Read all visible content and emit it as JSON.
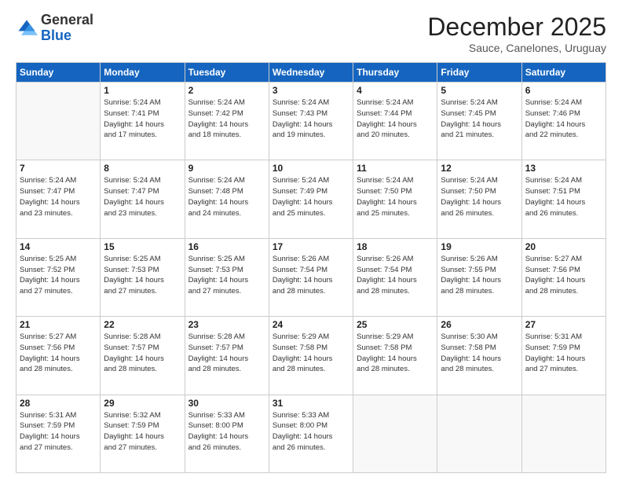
{
  "header": {
    "logo_general": "General",
    "logo_blue": "Blue",
    "month_title": "December 2025",
    "location": "Sauce, Canelones, Uruguay"
  },
  "days_of_week": [
    "Sunday",
    "Monday",
    "Tuesday",
    "Wednesday",
    "Thursday",
    "Friday",
    "Saturday"
  ],
  "weeks": [
    [
      {
        "day": "",
        "info": ""
      },
      {
        "day": "1",
        "info": "Sunrise: 5:24 AM\nSunset: 7:41 PM\nDaylight: 14 hours\nand 17 minutes."
      },
      {
        "day": "2",
        "info": "Sunrise: 5:24 AM\nSunset: 7:42 PM\nDaylight: 14 hours\nand 18 minutes."
      },
      {
        "day": "3",
        "info": "Sunrise: 5:24 AM\nSunset: 7:43 PM\nDaylight: 14 hours\nand 19 minutes."
      },
      {
        "day": "4",
        "info": "Sunrise: 5:24 AM\nSunset: 7:44 PM\nDaylight: 14 hours\nand 20 minutes."
      },
      {
        "day": "5",
        "info": "Sunrise: 5:24 AM\nSunset: 7:45 PM\nDaylight: 14 hours\nand 21 minutes."
      },
      {
        "day": "6",
        "info": "Sunrise: 5:24 AM\nSunset: 7:46 PM\nDaylight: 14 hours\nand 22 minutes."
      }
    ],
    [
      {
        "day": "7",
        "info": "Sunrise: 5:24 AM\nSunset: 7:47 PM\nDaylight: 14 hours\nand 23 minutes."
      },
      {
        "day": "8",
        "info": "Sunrise: 5:24 AM\nSunset: 7:47 PM\nDaylight: 14 hours\nand 23 minutes."
      },
      {
        "day": "9",
        "info": "Sunrise: 5:24 AM\nSunset: 7:48 PM\nDaylight: 14 hours\nand 24 minutes."
      },
      {
        "day": "10",
        "info": "Sunrise: 5:24 AM\nSunset: 7:49 PM\nDaylight: 14 hours\nand 25 minutes."
      },
      {
        "day": "11",
        "info": "Sunrise: 5:24 AM\nSunset: 7:50 PM\nDaylight: 14 hours\nand 25 minutes."
      },
      {
        "day": "12",
        "info": "Sunrise: 5:24 AM\nSunset: 7:50 PM\nDaylight: 14 hours\nand 26 minutes."
      },
      {
        "day": "13",
        "info": "Sunrise: 5:24 AM\nSunset: 7:51 PM\nDaylight: 14 hours\nand 26 minutes."
      }
    ],
    [
      {
        "day": "14",
        "info": "Sunrise: 5:25 AM\nSunset: 7:52 PM\nDaylight: 14 hours\nand 27 minutes."
      },
      {
        "day": "15",
        "info": "Sunrise: 5:25 AM\nSunset: 7:53 PM\nDaylight: 14 hours\nand 27 minutes."
      },
      {
        "day": "16",
        "info": "Sunrise: 5:25 AM\nSunset: 7:53 PM\nDaylight: 14 hours\nand 27 minutes."
      },
      {
        "day": "17",
        "info": "Sunrise: 5:26 AM\nSunset: 7:54 PM\nDaylight: 14 hours\nand 28 minutes."
      },
      {
        "day": "18",
        "info": "Sunrise: 5:26 AM\nSunset: 7:54 PM\nDaylight: 14 hours\nand 28 minutes."
      },
      {
        "day": "19",
        "info": "Sunrise: 5:26 AM\nSunset: 7:55 PM\nDaylight: 14 hours\nand 28 minutes."
      },
      {
        "day": "20",
        "info": "Sunrise: 5:27 AM\nSunset: 7:56 PM\nDaylight: 14 hours\nand 28 minutes."
      }
    ],
    [
      {
        "day": "21",
        "info": "Sunrise: 5:27 AM\nSunset: 7:56 PM\nDaylight: 14 hours\nand 28 minutes."
      },
      {
        "day": "22",
        "info": "Sunrise: 5:28 AM\nSunset: 7:57 PM\nDaylight: 14 hours\nand 28 minutes."
      },
      {
        "day": "23",
        "info": "Sunrise: 5:28 AM\nSunset: 7:57 PM\nDaylight: 14 hours\nand 28 minutes."
      },
      {
        "day": "24",
        "info": "Sunrise: 5:29 AM\nSunset: 7:58 PM\nDaylight: 14 hours\nand 28 minutes."
      },
      {
        "day": "25",
        "info": "Sunrise: 5:29 AM\nSunset: 7:58 PM\nDaylight: 14 hours\nand 28 minutes."
      },
      {
        "day": "26",
        "info": "Sunrise: 5:30 AM\nSunset: 7:58 PM\nDaylight: 14 hours\nand 28 minutes."
      },
      {
        "day": "27",
        "info": "Sunrise: 5:31 AM\nSunset: 7:59 PM\nDaylight: 14 hours\nand 27 minutes."
      }
    ],
    [
      {
        "day": "28",
        "info": "Sunrise: 5:31 AM\nSunset: 7:59 PM\nDaylight: 14 hours\nand 27 minutes."
      },
      {
        "day": "29",
        "info": "Sunrise: 5:32 AM\nSunset: 7:59 PM\nDaylight: 14 hours\nand 27 minutes."
      },
      {
        "day": "30",
        "info": "Sunrise: 5:33 AM\nSunset: 8:00 PM\nDaylight: 14 hours\nand 26 minutes."
      },
      {
        "day": "31",
        "info": "Sunrise: 5:33 AM\nSunset: 8:00 PM\nDaylight: 14 hours\nand 26 minutes."
      },
      {
        "day": "",
        "info": ""
      },
      {
        "day": "",
        "info": ""
      },
      {
        "day": "",
        "info": ""
      }
    ]
  ]
}
